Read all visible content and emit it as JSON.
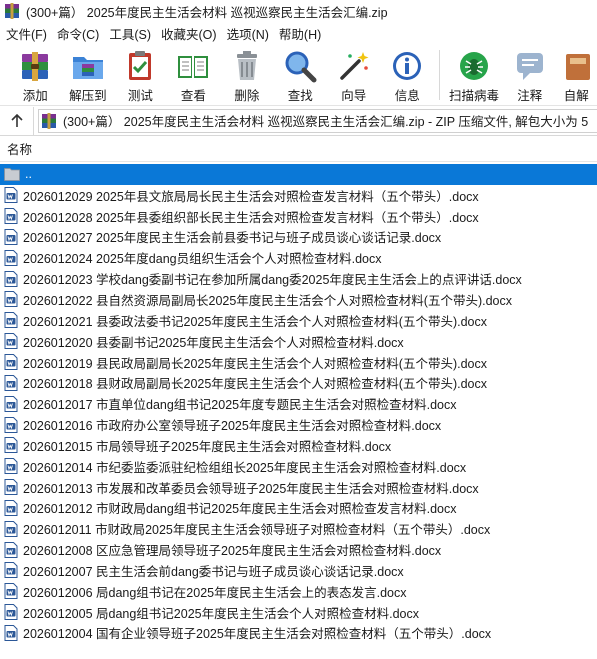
{
  "window": {
    "title": "(300+篇） 2025年度民主生活会材料 巡视巡察民主生活会汇编.zip"
  },
  "menu": [
    {
      "label": "文件(F)"
    },
    {
      "label": "命令(C)"
    },
    {
      "label": "工具(S)"
    },
    {
      "label": "收藏夹(O)"
    },
    {
      "label": "选项(N)"
    },
    {
      "label": "帮助(H)"
    }
  ],
  "toolbar": {
    "items": [
      {
        "label": "添加",
        "icon": "add-archive-icon"
      },
      {
        "label": "解压到",
        "icon": "extract-folder-icon"
      },
      {
        "label": "测试",
        "icon": "test-clipboard-icon"
      },
      {
        "label": "查看",
        "icon": "view-book-icon"
      },
      {
        "label": "删除",
        "icon": "trash-icon"
      },
      {
        "label": "查找",
        "icon": "magnifier-icon"
      },
      {
        "label": "向导",
        "icon": "wizard-wand-icon"
      },
      {
        "label": "信息",
        "icon": "info-icon"
      },
      {
        "label": "扫描病毒",
        "icon": "virus-scan-icon"
      },
      {
        "label": "注释",
        "icon": "comment-icon"
      },
      {
        "label": "自解",
        "icon": "sfx-icon"
      }
    ]
  },
  "address": {
    "path": "(300+篇） 2025年度民主生活会材料 巡视巡察民主生活会汇编.zip - ZIP 压缩文件, 解包大小为 5"
  },
  "columns": {
    "name": "名称"
  },
  "files": {
    "parent": "..",
    "items": [
      "2026012029 2025年县文旅局局长民主生活会对照检查发言材料（五个带头）.docx",
      "2026012028 2025年县委组织部长民主生活会对照检查发言材料（五个带头）.docx",
      "2026012027 2025年度民主生活会前县委书记与班子成员谈心谈话记录.docx",
      "2026012024 2025年度dang员组织生活会个人对照检查材料.docx",
      "2026012023 学校dang委副书记在参加所属dang委2025年度民主生活会上的点评讲话.docx",
      "2026012022 县自然资源局副局长2025年度民主生活会个人对照检查材料(五个带头).docx",
      "2026012021 县委政法委书记2025年度民主生活会个人对照检查材料(五个带头).docx",
      "2026012020 县委副书记2025年度民主生活会个人对照检查材料.docx",
      "2026012019 县民政局副局长2025年度民主生活会个人对照检查材料(五个带头).docx",
      "2026012018 县财政局副局长2025年度民主生活会个人对照检查材料(五个带头).docx",
      "2026012017 市直单位dang组书记2025年度专题民主生活会对照检查材料.docx",
      "2026012016 市政府办公室领导班子2025年度民主生活会对照检查材料.docx",
      "2026012015 市局领导班子2025年度民主生活会对照检查材料.docx",
      "2026012014 市纪委监委派驻纪检组组长2025年度民主生活会对照检查材料.docx",
      "2026012013 市发展和改革委员会领导班子2025年度民主生活会对照检查材料.docx",
      "2026012012 市财政局dang组书记2025年度民主生活会对照检查发言材料.docx",
      "2026012011 市财政局2025年度民主生活会领导班子对照检查材料（五个带头）.docx",
      "2026012008 区应急管理局领导班子2025年度民主生活会对照检查材料.docx",
      "2026012007 民主生活会前dang委书记与班子成员谈心谈话记录.docx",
      "2026012006 局dang组书记在2025年度民主生活会上的表态发言.docx",
      "2026012005 局dang组书记2025年度民主生活会个人对照检查材料.docx",
      "2026012004 国有企业领导班子2025年度民主生活会对照检查材料（五个带头）.docx"
    ]
  },
  "colors": {
    "selection": "#0a78d7",
    "docx_blue": "#2b5797"
  }
}
